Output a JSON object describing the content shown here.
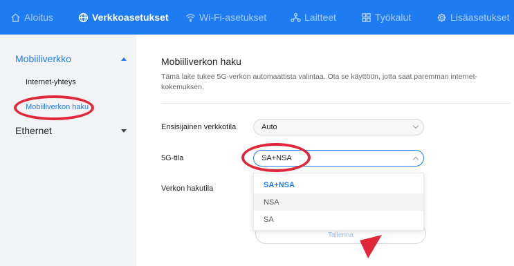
{
  "nav": {
    "items": [
      {
        "label": "Aloitus",
        "icon": "home-icon"
      },
      {
        "label": "Verkkoasetukset",
        "icon": "globe-icon",
        "active": true
      },
      {
        "label": "Wi-Fi-asetukset",
        "icon": "wifi-icon"
      },
      {
        "label": "Laitteet",
        "icon": "devices-icon"
      },
      {
        "label": "Työkalut",
        "icon": "tools-icon"
      },
      {
        "label": "Lisäasetukset",
        "icon": "gear-icon"
      }
    ]
  },
  "sidebar": {
    "section1": "Mobiiliverkko",
    "items": [
      "Internet-yhteys",
      "Mobiiliverkon haku"
    ],
    "section2": "Ethernet"
  },
  "main": {
    "title": "Mobiiliverkon haku",
    "description": "Tämä laite tukee 5G-verkon automaattista valintaa. Ota se käyttöön, jotta saat paremman internet-kokemuksen.",
    "fields": {
      "preferred_label": "Ensisijainen verkkotila",
      "preferred_value": "Auto",
      "mode_label": "5G-tila",
      "mode_value": "SA+NSA",
      "search_label": "Verkon hakutila"
    },
    "options": [
      "SA+NSA",
      "NSA",
      "SA"
    ],
    "save_label": "Tallenna"
  },
  "colors": {
    "accent": "#1e7bf2",
    "annotation": "#e0283a"
  }
}
